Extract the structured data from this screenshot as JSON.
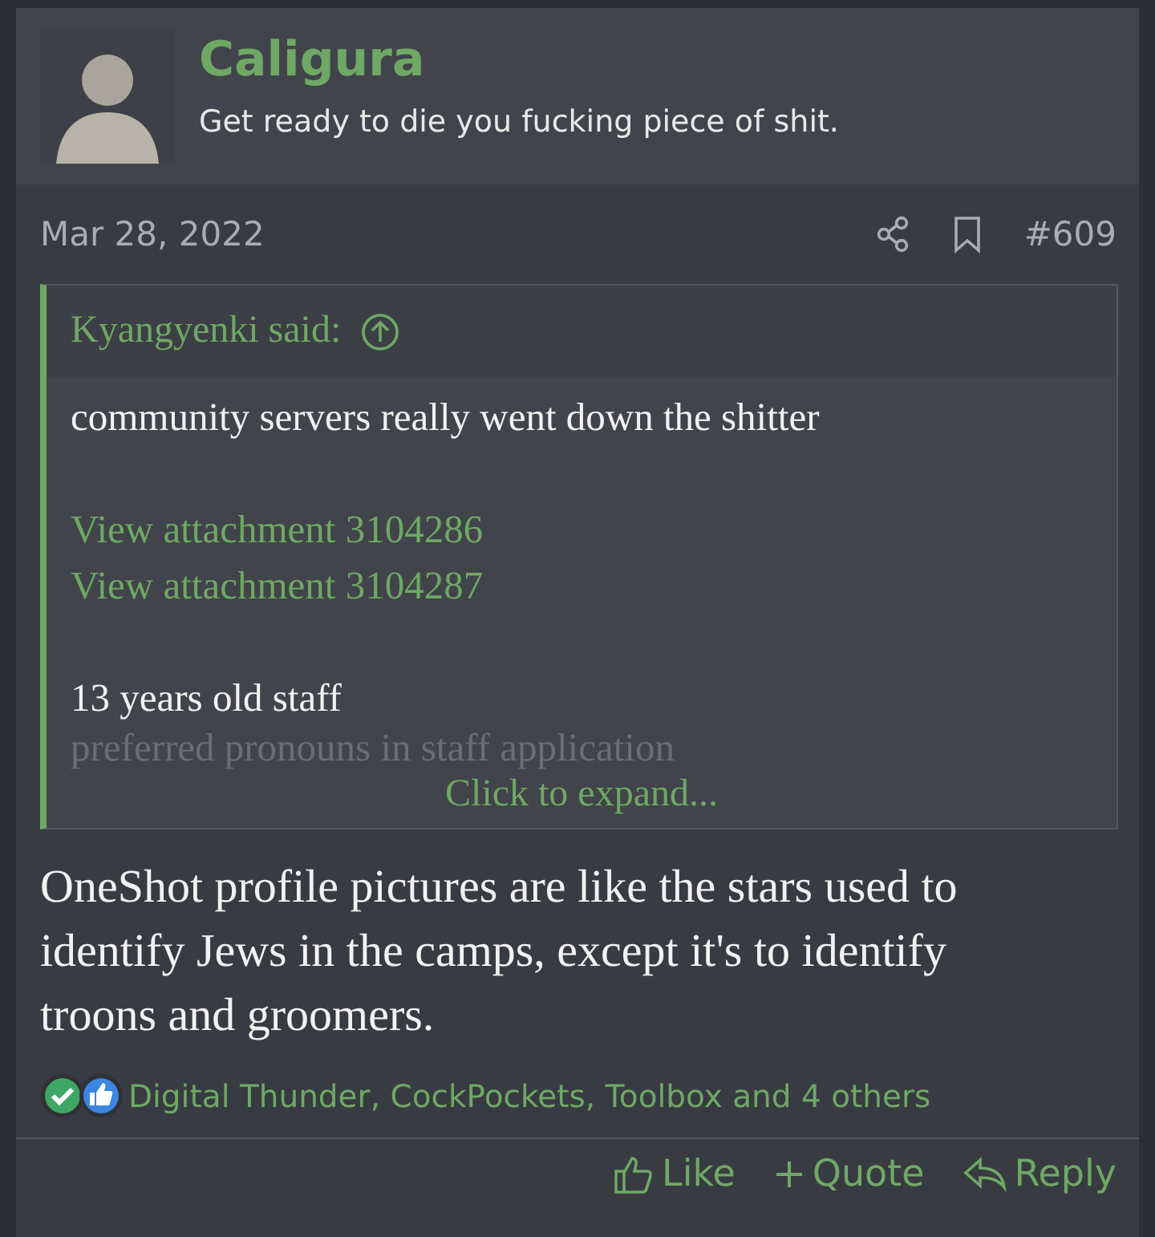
{
  "author": {
    "name": "Caligura",
    "signature": "Get ready to die you fucking piece of shit."
  },
  "post": {
    "date": "Mar 28, 2022",
    "number": "#609"
  },
  "quote": {
    "attribution": "Kyangyenki said:",
    "collapsed": true,
    "expand_label": "Click to expand...",
    "paragraphs": [
      [
        {
          "kind": "text",
          "text": "community servers really went down the shitter"
        }
      ],
      [
        {
          "kind": "link",
          "text": "View attachment 3104286"
        },
        {
          "kind": "link",
          "text": "View attachment 3104287"
        }
      ],
      [
        {
          "kind": "text",
          "text": "13 years old staff"
        },
        {
          "kind": "text",
          "text": "preferred pronouns in staff application"
        }
      ]
    ]
  },
  "body": "OneShot profile pictures are like the stars used to identify Jews in the camps, except it's to identify troons and groomers.",
  "reactions": {
    "types": [
      {
        "kind": "agree"
      },
      {
        "kind": "like"
      }
    ],
    "summary": "Digital Thunder, CockPockets, Toolbox and 4 others"
  },
  "actions": [
    {
      "kind": "like",
      "label": "Like"
    },
    {
      "kind": "quote",
      "label": "Quote"
    },
    {
      "kind": "reply",
      "label": "Reply"
    }
  ]
}
